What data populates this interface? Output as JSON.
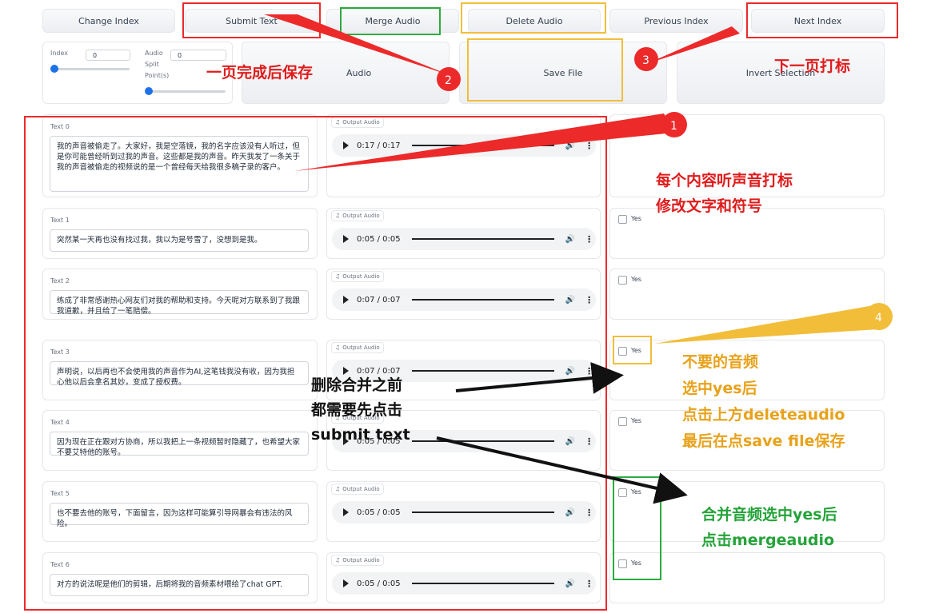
{
  "toolbar": {
    "change_index": "Change Index",
    "submit_text": "Submit Text",
    "merge_audio": "Merge Audio",
    "delete_audio": "Delete Audio",
    "previous_index": "Previous Index",
    "next_index": "Next Index"
  },
  "controls": {
    "index_label": "Index",
    "index_value": "0",
    "split_label_1": "Audio",
    "split_label_2": "Split",
    "split_label_3": "Point(s)",
    "split_value": "0",
    "save_file": "Save File",
    "invert_selection": "Invert Selection",
    "hidden_audio_label": "Audio"
  },
  "rows": [
    {
      "label": "Text 0",
      "text": "我的声音被偷走了。大家好，我是空落镜，我的名字应该没有人听过，但是你可能曾经听到过我的声音。这些都是我的声音。昨天我发了一条关于我的声音被偷走的视频说的是一个曾经每天给我很多稿子录的客户。",
      "audio_label": "Output Audio",
      "time": "0:17 / 0:17",
      "check": ""
    },
    {
      "label": "Text 1",
      "text": "突然某一天再也没有找过我，我以为是号雪了，没想到是我。",
      "audio_label": "Output Audio",
      "time": "0:05 / 0:05",
      "check": "Yes"
    },
    {
      "label": "Text 2",
      "text": "练成了非常感谢热心网友们对我的帮助和支持。今天呢对方联系到了我跟我道歉，并且给了一笔赔偿。",
      "audio_label": "Output Audio",
      "time": "0:07 / 0:07",
      "check": "Yes"
    },
    {
      "label": "Text 3",
      "text": "声明说，以后再也不会使用我的声音作为AI,这笔钱我没有收，因为我担心他以后会拿名其妙，变成了授权费。",
      "audio_label": "Output Audio",
      "time": "0:07 / 0:07",
      "check": "Yes"
    },
    {
      "label": "Text 4",
      "text": "因为现在正在跟对方协商，所以我把上一条视频暂时隐藏了，也希望大家不要艾特他的账号。",
      "audio_label": "Output Audio",
      "time": "0:05 / 0:05",
      "check": "Yes"
    },
    {
      "label": "Text 5",
      "text": "也不要去他的账号，下面留言，因为这样可能算引导网暴会有违法的风险。",
      "audio_label": "Output Audio",
      "time": "0:05 / 0:05",
      "check": "Yes"
    },
    {
      "label": "Text 6",
      "text": "对方的说法呢是他们的剪辑，后期将我的音频素材喂给了chat GPT.",
      "audio_label": "Output Audio",
      "time": "0:05 / 0:05",
      "check": "Yes"
    }
  ],
  "annotations": {
    "save_after_page": "一页完成后保存",
    "next_page_label": "下一页打标",
    "listen_1": "每个内容听声音打标",
    "listen_2": "修改文字和符号",
    "delete_1": "不要的音频",
    "delete_2": "选中yes后",
    "delete_3": "点击上方deleteaudio",
    "delete_4": "最后在点save file保存",
    "submit_1": "删除合并之前",
    "submit_2": "都需要先点击",
    "submit_3": "submit text",
    "merge_1": "合并音频选中yes后",
    "merge_2": "点击mergeaudio",
    "num_1": "1",
    "num_2": "2",
    "num_3": "3",
    "num_4": "4"
  },
  "colors": {
    "red": "#ec2a2a",
    "green": "#2bab3f",
    "yellow": "#f2be3a",
    "slider_blue": "#1e72e8"
  },
  "icons": {
    "music": "music-note-icon",
    "play": "play-icon",
    "volume": "volume-icon",
    "more": "more-vert-icon"
  }
}
